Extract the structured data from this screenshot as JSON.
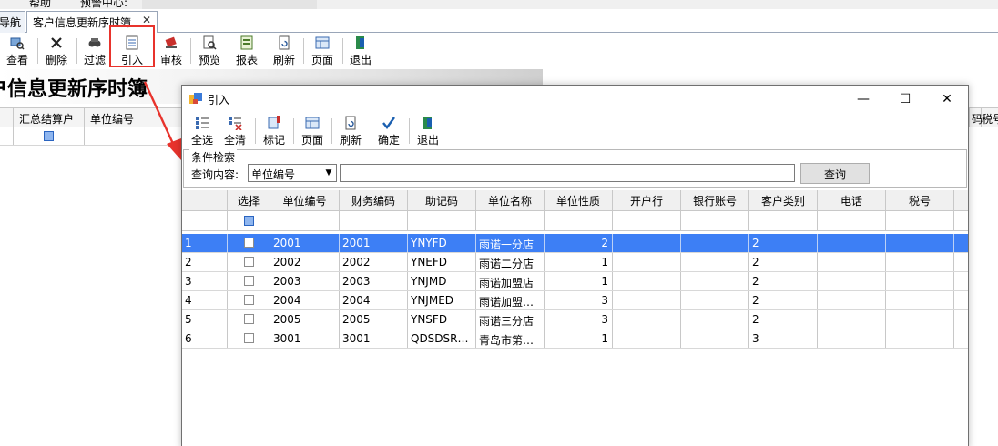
{
  "colors": {
    "accent": "#3d7ff5",
    "highlight_box": "#e8332c",
    "arrow": "#e8332c"
  },
  "main": {
    "menu": {
      "item1": "帮助",
      "item2": "预警中心:"
    },
    "tabs": {
      "nav": "导航",
      "active": "客户信息更新序时簿",
      "close": "✕"
    },
    "toolbar": [
      {
        "label": "查看",
        "icon": "view-icon"
      },
      {
        "label": "删除",
        "icon": "delete-icon"
      },
      {
        "label": "过滤",
        "icon": "filter-icon"
      },
      {
        "label": "引入",
        "icon": "import-icon"
      },
      {
        "label": "审核",
        "icon": "audit-icon"
      },
      {
        "label": "预览",
        "icon": "preview-icon"
      },
      {
        "label": "报表",
        "icon": "report-icon"
      },
      {
        "label": "刷新",
        "icon": "refresh-icon"
      },
      {
        "label": "页面",
        "icon": "page-icon"
      },
      {
        "label": "退出",
        "icon": "exit-icon"
      }
    ],
    "title": "户信息更新序时簿",
    "grid_headers": {
      "col1": "汇总结算户",
      "col2": "单位编号",
      "right_col": "码",
      "right_col2": "税号"
    }
  },
  "dialog": {
    "title": "引入",
    "window_buttons": {
      "minimize": "—",
      "maximize": "☐",
      "close": "✕"
    },
    "toolbar": [
      {
        "label": "全选",
        "icon": "select-all-icon"
      },
      {
        "label": "全清",
        "icon": "clear-all-icon"
      },
      {
        "label": "标记",
        "icon": "mark-icon"
      },
      {
        "label": "页面",
        "icon": "page-icon"
      },
      {
        "label": "刷新",
        "icon": "refresh-icon"
      },
      {
        "label": "确定",
        "icon": "confirm-icon"
      },
      {
        "label": "退出",
        "icon": "exit-icon"
      }
    ],
    "search": {
      "legend": "条件检索",
      "label": "查询内容:",
      "field_selected": "单位编号",
      "text_value": "",
      "button": "查询"
    },
    "grid": {
      "headers": [
        "选择",
        "单位编号",
        "财务编码",
        "助记码",
        "单位名称",
        "单位性质",
        "开户行",
        "银行账号",
        "客户类别",
        "电话",
        "税号"
      ],
      "rows": [
        {
          "n": "1",
          "code": "2001",
          "fin": "2001",
          "mnem": "YNYFD",
          "name": "雨诺一分店",
          "nature": "2",
          "bank": "",
          "acct": "",
          "cat": "2",
          "tel": "",
          "tax": ""
        },
        {
          "n": "2",
          "code": "2002",
          "fin": "2002",
          "mnem": "YNEFD",
          "name": "雨诺二分店",
          "nature": "1",
          "bank": "",
          "acct": "",
          "cat": "2",
          "tel": "",
          "tax": ""
        },
        {
          "n": "3",
          "code": "2003",
          "fin": "2003",
          "mnem": "YNJMD",
          "name": "雨诺加盟店",
          "nature": "1",
          "bank": "",
          "acct": "",
          "cat": "2",
          "tel": "",
          "tax": ""
        },
        {
          "n": "4",
          "code": "2004",
          "fin": "2004",
          "mnem": "YNJMED",
          "name": "雨诺加盟…",
          "nature": "3",
          "bank": "",
          "acct": "",
          "cat": "2",
          "tel": "",
          "tax": ""
        },
        {
          "n": "5",
          "code": "2005",
          "fin": "2005",
          "mnem": "YNSFD",
          "name": "雨诺三分店",
          "nature": "3",
          "bank": "",
          "acct": "",
          "cat": "2",
          "tel": "",
          "tax": ""
        },
        {
          "n": "6",
          "code": "3001",
          "fin": "3001",
          "mnem": "QDSDSRM…",
          "name": "青岛市第…",
          "nature": "1",
          "bank": "",
          "acct": "",
          "cat": "3",
          "tel": "",
          "tax": ""
        }
      ],
      "selected_row_index": 0
    }
  }
}
